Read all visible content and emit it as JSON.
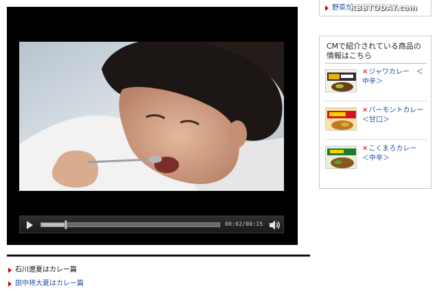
{
  "player": {
    "time": "00:02/00:15",
    "progress": 0.14
  },
  "episodes": [
    {
      "label": "石川遼夏はカレー篇",
      "current": true
    },
    {
      "label": "田中将大夏はカレー篇",
      "current": false
    }
  ],
  "top_link": {
    "label": "野菜が"
  },
  "watermark": "RBBTODAY.com",
  "panel": {
    "title": "CMで紹介されている商品の情報はこちら",
    "products": [
      {
        "label": "ジャワカレー　＜中辛＞",
        "icon": "java-curry-box"
      },
      {
        "label": "バーモントカレー＜甘口＞",
        "icon": "vermont-curry-box"
      },
      {
        "label": "こくまろカレー　＜中辛＞",
        "icon": "kokumaro-curry-box"
      }
    ]
  },
  "colors": {
    "accent_red": "#d40000",
    "link_blue": "#1f4fa3"
  }
}
